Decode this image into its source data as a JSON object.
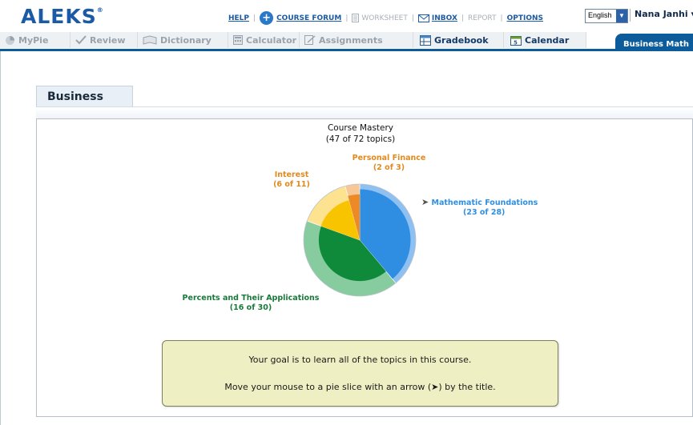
{
  "header": {
    "logo": "ALEKS",
    "logo_mark": "®",
    "links": {
      "help": "HELP",
      "course_forum": "COURSE FORUM",
      "worksheet": "WORKSHEET",
      "inbox": "INBOX",
      "report": "REPORT",
      "options": "OPTIONS"
    },
    "language": "English",
    "user_name": "Nana Janhi ▾"
  },
  "tabs": {
    "mypie": "MyPie",
    "review": "Review",
    "dictionary": "Dictionary",
    "calculator": "Calculator",
    "assignments": "Assignments",
    "gradebook": "Gradebook",
    "calendar": "Calendar",
    "course": "Business Math"
  },
  "main": {
    "tab_title": "Business Math",
    "mastery_title": "Course Mastery",
    "mastery_sub": "(47 of 72 topics)",
    "goal_line1": "Your goal is to learn all of the topics in this course.",
    "goal_line2": "Move your mouse to a pie slice with an arrow (➤) by the title."
  },
  "pie_labels": {
    "personal_finance": {
      "name": "Personal Finance",
      "count": "(2 of 3)"
    },
    "interest": {
      "name": "Interest",
      "count": "(6 of 11)"
    },
    "math_foundations": {
      "name": "Mathematic Foundations",
      "count": "(23 of 28)",
      "arrow": "➤"
    },
    "percents": {
      "name": "Percents and Their Applications",
      "count": "(16 of 30)"
    }
  },
  "chart_data": {
    "type": "pie",
    "title": "Course Mastery",
    "subtitle": "(47 of 72 topics)",
    "series": [
      {
        "name": "Mathematic Foundations",
        "total": 28,
        "mastered": 23,
        "color_total": "#8ec0f2",
        "color_mastered": "#2f8ee2"
      },
      {
        "name": "Percents and Their Applications",
        "total": 30,
        "mastered": 16,
        "color_total": "#86cc9e",
        "color_mastered": "#0f8a3a"
      },
      {
        "name": "Interest",
        "total": 11,
        "mastered": 6,
        "color_total": "#fde290",
        "color_mastered": "#f8c400"
      },
      {
        "name": "Personal Finance",
        "total": 3,
        "mastered": 2,
        "color_total": "#f7c795",
        "color_mastered": "#ee8a25"
      }
    ]
  },
  "colors": {
    "brand": "#1a5aa6",
    "tab_bar": "#0c5b9a",
    "goal_bg": "#efefc4"
  }
}
